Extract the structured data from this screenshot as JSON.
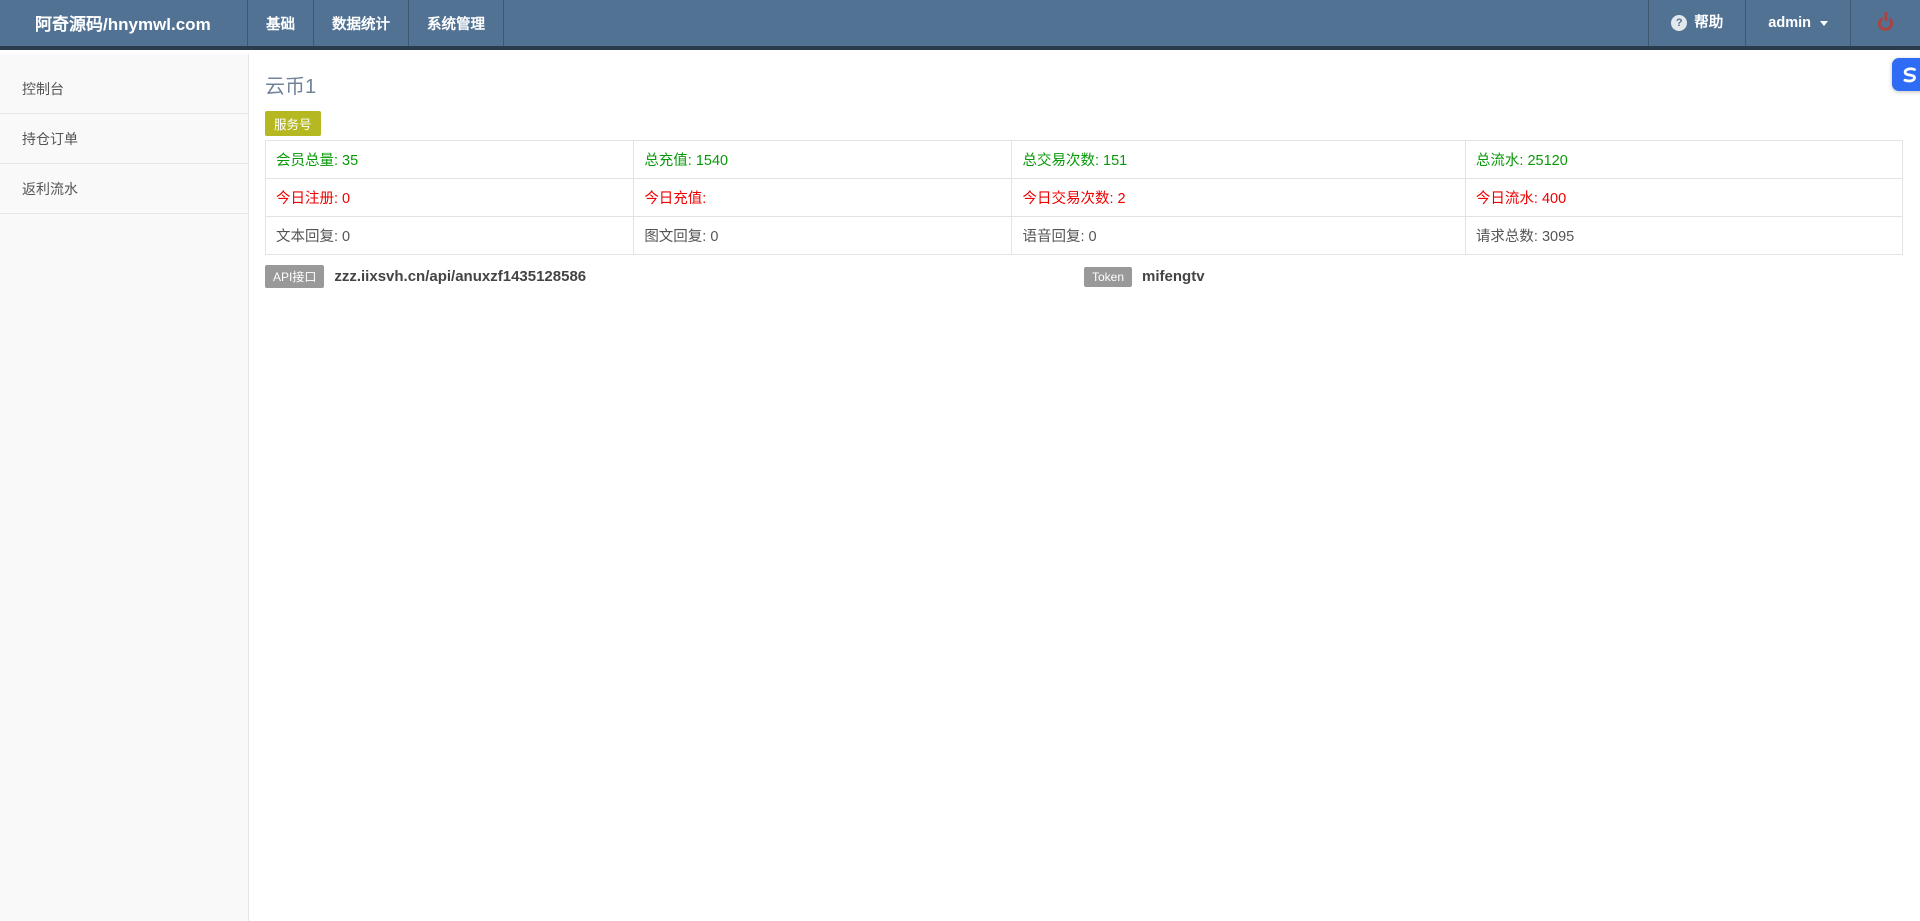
{
  "navbar": {
    "brand": "阿奇源码/hnymwl.com",
    "menu": [
      {
        "label": "基础"
      },
      {
        "label": "数据统计"
      },
      {
        "label": "系统管理"
      }
    ],
    "help_label": "帮助",
    "help_icon_glyph": "?",
    "user_label": "admin"
  },
  "sidebar": {
    "items": [
      {
        "label": "控制台"
      },
      {
        "label": "持仓订单"
      },
      {
        "label": "返利流水"
      }
    ]
  },
  "main": {
    "title": "云币1",
    "account_type_badge": "服务号",
    "stats_table": {
      "rows": [
        {
          "status": "green",
          "cells": [
            "会员总量: 35",
            "总充值: 1540",
            "总交易次数: 151",
            "总流水: 25120"
          ]
        },
        {
          "status": "red",
          "cells": [
            "今日注册: 0",
            "今日充值:",
            "今日交易次数: 2",
            "今日流水: 400"
          ]
        },
        {
          "status": "gray",
          "cells": [
            "文本回复: 0",
            "图文回复: 0",
            "语音回复: 0",
            "请求总数: 3095"
          ]
        }
      ]
    },
    "api": {
      "label": "API接口",
      "url": "zzz.iixsvh.cn/api/anuxzf1435128586"
    },
    "token": {
      "label": "Token",
      "value": "mifengtv"
    }
  },
  "colors": {
    "navbar_bg": "#527294",
    "navbar_border": "#2b3b4e",
    "badge_yellow": "#b5b821",
    "stat_green": "#089908",
    "stat_red": "#ee0000",
    "gray_badge": "#999999",
    "overlay_blue": "#2e6cf6",
    "power_red": "#a94442",
    "title_color": "#708399"
  }
}
